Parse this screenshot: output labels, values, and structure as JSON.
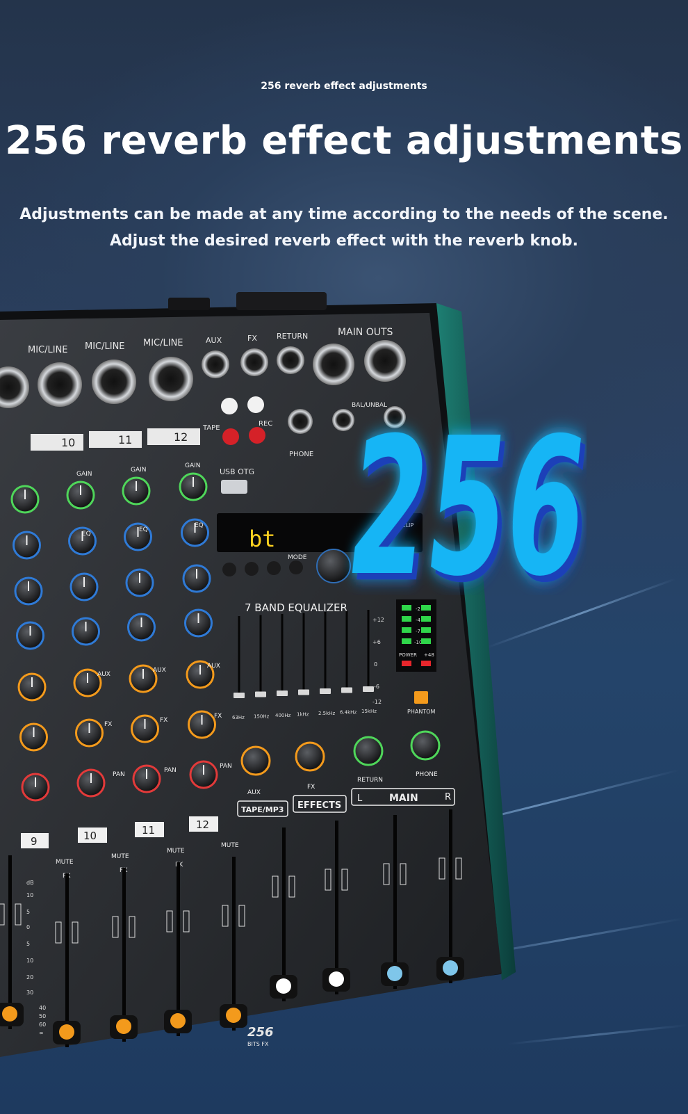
{
  "header": {
    "kicker": "256 reverb effect adjustments",
    "title": "256 reverb effect adjustments",
    "subtitle_line1": "Adjustments can be made at any time according to the needs of the scene.",
    "subtitle_line2": "Adjust the desired reverb effect with the reverb knob."
  },
  "badge": {
    "text": "256",
    "color": "#12b5f5"
  },
  "mixer": {
    "input_label": "MIC/LINE",
    "channels": [
      "9",
      "10",
      "11",
      "12"
    ],
    "knob_gain": "GAIN",
    "knob_eq": "EQ",
    "knob_aux": "AUX",
    "knob_fx": "FX",
    "knob_pan": "PAN",
    "mute": "MUTE",
    "pk": "PK",
    "io_labels": {
      "aux": "AUX",
      "fx": "FX",
      "return": "RETURN",
      "main_outs": "MAIN OUTS",
      "l": "L",
      "r": "R",
      "tape": "TAPE",
      "rec": "REC",
      "phone": "PHONE",
      "bal": "BAL/UNBAL",
      "usb_otg": "USB OTG"
    },
    "display": {
      "left": "bt",
      "mode": "MODE",
      "clip": "CLIP"
    },
    "eq_title": "7 BAND EQUALIZER",
    "eq_bands": [
      "63Hz",
      "150Hz",
      "400Hz",
      "1kHz",
      "2.5kHz",
      "6.4kHz",
      "15kHz"
    ],
    "eq_scale": [
      "+12",
      "+6",
      "0",
      "-6",
      "-12"
    ],
    "meter_labels": [
      "-2",
      "-4",
      "-7",
      "-10"
    ],
    "power": "POWER",
    "plus48": "+48",
    "phantom": "PHANTOM",
    "send_knobs": [
      "AUX",
      "FX",
      "RETURN",
      "PHONE"
    ],
    "strip_labels": {
      "tape": "TAPE/MP3",
      "effects": "EFFECTS",
      "main": "MAIN"
    },
    "fader_scale": [
      "dB",
      "10",
      "5",
      "0",
      "5",
      "10",
      "20",
      "30",
      "40",
      "50",
      "60",
      "∞"
    ],
    "brand": "256",
    "brand_sub": "BITS FX"
  }
}
